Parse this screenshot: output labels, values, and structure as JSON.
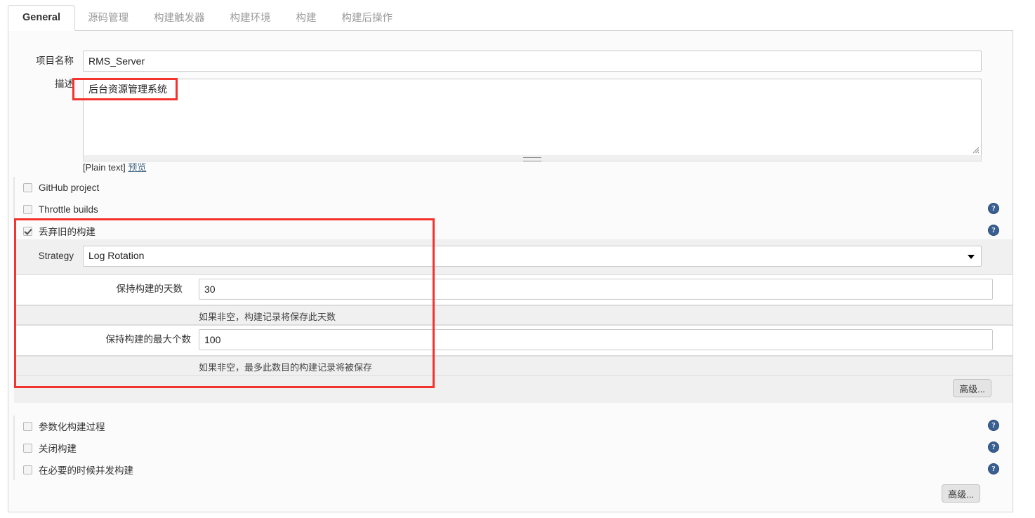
{
  "tabs": [
    {
      "label": "General",
      "active": true
    },
    {
      "label": "源码管理",
      "active": false
    },
    {
      "label": "构建触发器",
      "active": false
    },
    {
      "label": "构建环境",
      "active": false
    },
    {
      "label": "构建",
      "active": false
    },
    {
      "label": "构建后操作",
      "active": false
    }
  ],
  "form": {
    "project_name_label": "项目名称",
    "project_name_value": "RMS_Server",
    "description_label": "描述",
    "description_value": "后台资源管理系统",
    "plain_text_marker": "[Plain text]",
    "preview_link": "预览"
  },
  "options": [
    {
      "label": "GitHub project",
      "checked": false
    },
    {
      "label": "Throttle builds",
      "checked": false
    },
    {
      "label": "丢弃旧的构建",
      "checked": true
    }
  ],
  "discard": {
    "strategy_label": "Strategy",
    "strategy_value": "Log Rotation",
    "days_label": "保持构建的天数",
    "days_value": "30",
    "days_hint": "如果非空，构建记录将保存此天数",
    "max_label": "保持构建的最大个数",
    "max_value": "100",
    "max_hint": "如果非空，最多此数目的构建记录将被保存",
    "advanced_label": "高级..."
  },
  "bottom_options": [
    {
      "label": "参数化构建过程",
      "checked": false
    },
    {
      "label": "关闭构建",
      "checked": false
    },
    {
      "label": "在必要的时候并发构建",
      "checked": false
    }
  ],
  "bottom_advanced_label": "高级...",
  "help_icon_glyph": "?",
  "icons": {
    "help": "help-icon",
    "dropdown": "chevron-down-icon",
    "resize": "resize-grip-icon"
  },
  "colors": {
    "annotation": "#f4322e",
    "help_blue": "#3a5f93",
    "panel_bg": "#fbfbfb",
    "block_bg": "#f0f0f0"
  }
}
